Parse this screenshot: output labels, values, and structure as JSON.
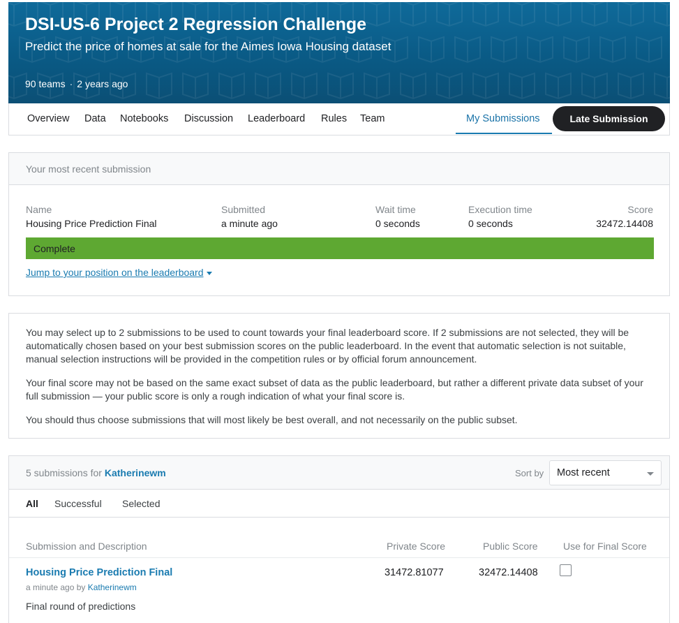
{
  "banner": {
    "title": "DSI-US-6 Project 2 Regression Challenge",
    "subtitle": "Predict the price of homes at sale for the Aimes Iowa Housing dataset",
    "teams": "90 teams",
    "separator": "·",
    "age": "2 years ago",
    "color": "#0b5d8a"
  },
  "tabs": {
    "items": [
      "Overview",
      "Data",
      "Notebooks",
      "Discussion",
      "Leaderboard",
      "Rules",
      "Team"
    ],
    "my_submissions": "My Submissions",
    "late_submission": "Late Submission"
  },
  "recent": {
    "header": "Your most recent submission",
    "name_label": "Name",
    "name_value": "Housing Price Prediction Final",
    "submitted_label": "Submitted",
    "submitted_value": "a minute ago",
    "wait_label": "Wait time",
    "wait_value": "0 seconds",
    "exec_label": "Execution time",
    "exec_value": "0 seconds",
    "score_label": "Score",
    "score_value": "32472.14408",
    "status": "Complete",
    "status_color": "#5ea832",
    "jump_link": "Jump to your position on the leaderboard"
  },
  "info": {
    "p1": "You may select up to 2 submissions to be used to count towards your final leaderboard score. If 2 submissions are not selected, they will be automatically chosen based on your best submission scores on the public leaderboard. In the event that automatic selection is not suitable, manual selection instructions will be provided in the competition rules or by official forum announcement.",
    "p2": "Your final score may not be based on the same exact subset of data as the public leaderboard, but rather a different private data subset of your full submission — your public score is only a rough indication of what your final score is.",
    "p3": "You should thus choose submissions that will most likely be best overall, and not necessarily on the public subset."
  },
  "submissions": {
    "count_text": "5 submissions for",
    "user": "Katherinewm",
    "sort_label": "Sort by",
    "sort_value": "Most recent",
    "filters": [
      "All",
      "Successful",
      "Selected"
    ],
    "columns": {
      "desc": "Submission and Description",
      "private": "Private Score",
      "public": "Public Score",
      "final": "Use for Final Score"
    },
    "rows": [
      {
        "title": "Housing Price Prediction Final",
        "time": "a minute ago by",
        "by": "Katherinewm",
        "description": "Final round of predictions",
        "private_score": "31472.81077",
        "public_score": "32472.14408",
        "selected": false
      }
    ]
  }
}
